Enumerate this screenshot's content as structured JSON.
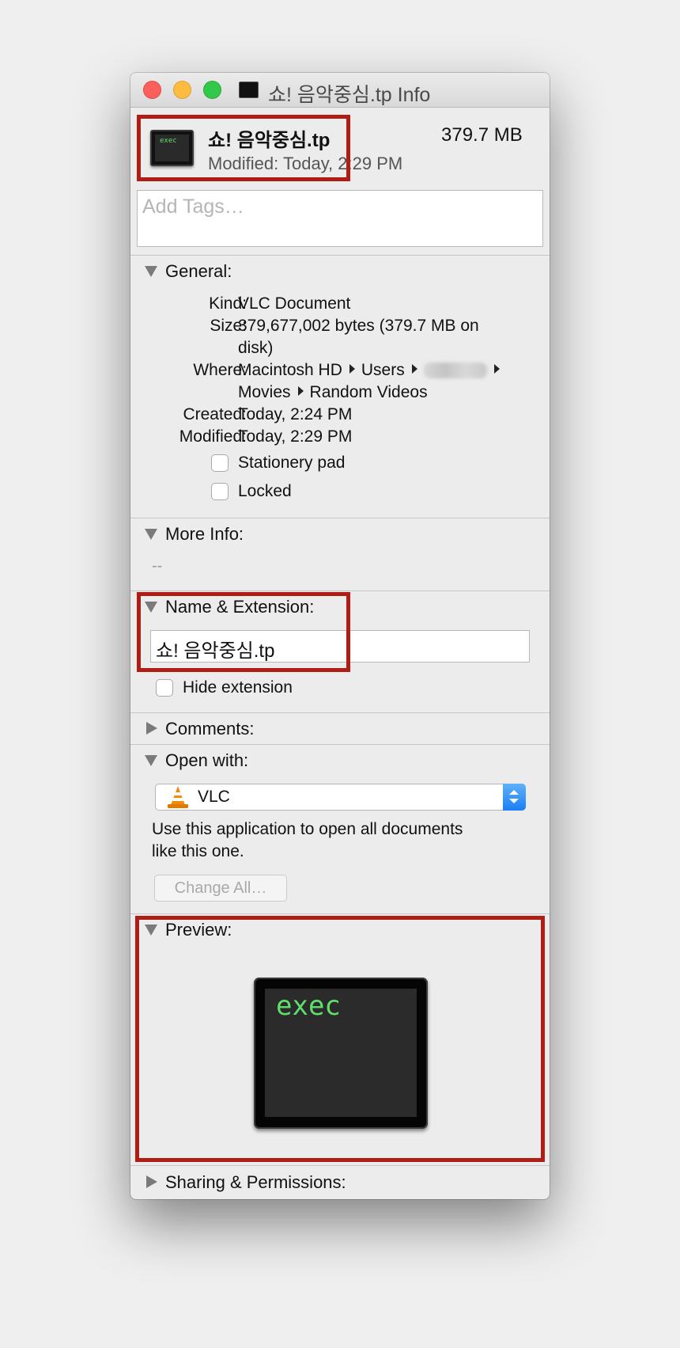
{
  "window": {
    "title": "쇼! 음악중심.tp Info"
  },
  "header": {
    "file_icon_text": "exec",
    "file_name": "쇼! 음악중심.tp",
    "modified": "Modified: Today, 2:29 PM",
    "size": "379.7 MB"
  },
  "tags": {
    "placeholder": "Add Tags…"
  },
  "general": {
    "title": "General:",
    "kind_label": "Kind:",
    "kind_value": "VLC Document",
    "size_label": "Size:",
    "size_value_line1": "379,677,002 bytes (379.7 MB on",
    "size_value_line2": "disk)",
    "where_label": "Where:",
    "where_path": [
      "Macintosh HD",
      "Users",
      "Movies",
      "Random Videos"
    ],
    "created_label": "Created:",
    "created_value": "Today, 2:24 PM",
    "modified_label": "Modified:",
    "modified_value": "Today, 2:29 PM",
    "stationery_label": "Stationery pad",
    "stationery_checked": false,
    "locked_label": "Locked",
    "locked_checked": false
  },
  "more_info": {
    "title": "More Info:",
    "value": "--"
  },
  "name_extension": {
    "title": "Name & Extension:",
    "name_value": "쇼! 음악중심.tp",
    "hide_extension_label": "Hide extension",
    "hide_extension_checked": false
  },
  "comments": {
    "title": "Comments:"
  },
  "open_with": {
    "title": "Open with:",
    "app_name": "VLC",
    "description_line1": "Use this application to open all documents",
    "description_line2": "like this one.",
    "change_all_label": "Change All…"
  },
  "preview": {
    "title": "Preview:",
    "icon_text": "exec"
  },
  "sharing": {
    "title": "Sharing & Permissions:"
  },
  "colors": {
    "highlight": "#b01d15",
    "vlc_orange": "#f28a0e",
    "exec_green": "#5fe06a",
    "stepper_blue": "#1a7ef5"
  }
}
